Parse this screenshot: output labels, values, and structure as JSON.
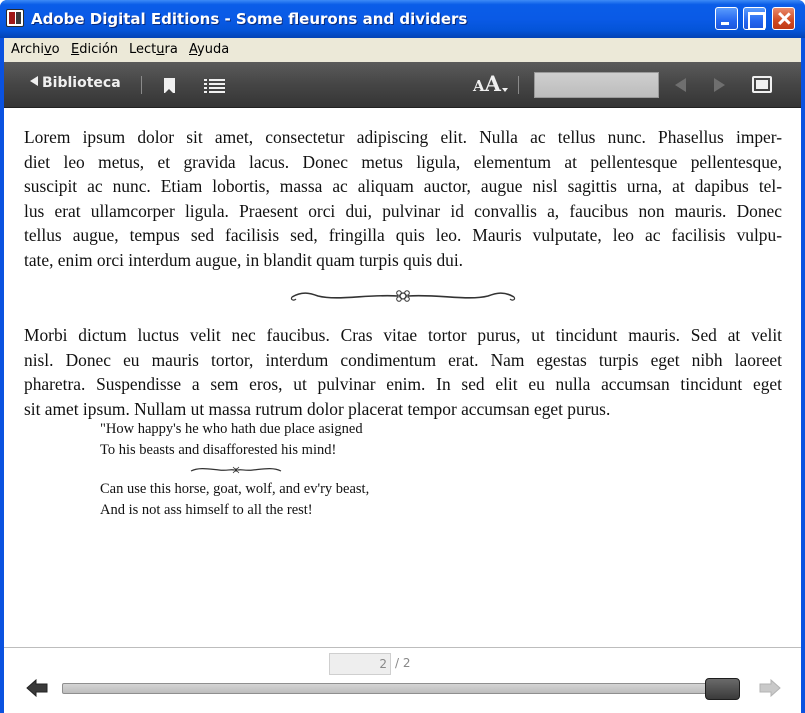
{
  "window": {
    "title": "Adobe Digital Editions - Some fleurons and dividers"
  },
  "menubar": {
    "items": [
      {
        "pre": "Archi",
        "acc": "v",
        "post": "o"
      },
      {
        "pre": "",
        "acc": "E",
        "post": "dición"
      },
      {
        "pre": "Lect",
        "acc": "u",
        "post": "ra"
      },
      {
        "pre": "",
        "acc": "A",
        "post": "yuda"
      }
    ]
  },
  "toolbar": {
    "library_label": "Biblioteca",
    "font_size_small": "A",
    "font_size_large": "A",
    "search_value": ""
  },
  "content": {
    "para1_lines": [
      "Lorem ipsum dolor sit amet, consectetur adipiscing elit. Nulla ac tellus nunc. Phasellus imper-",
      "diet leo metus, et gravida lacus. Donec metus ligula, elementum at pellentesque pellentesque,",
      "suscipit ac nunc. Etiam lobortis, massa ac aliquam auctor, augue nisl sagittis urna, at dapibus tel-",
      "lus erat ullamcorper ligula. Praesent orci dui, pulvinar id convallis a, faucibus non mauris. Donec",
      "tellus augue, tempus sed facilisis sed, fringilla quis leo. Mauris vulputate, leo ac facilisis vulpu-",
      "tate, enim orci interdum augue, in blandit quam turpis quis dui."
    ],
    "para2_lines": [
      "Morbi dictum luctus velit nec faucibus. Cras vitae tortor purus, ut tincidunt mauris. Sed at velit",
      "nisl. Donec eu mauris tortor, interdum condimentum erat. Nam egestas turpis eget nibh laoreet",
      "pharetra. Suspendisse a sem eros, ut pulvinar enim. In sed elit eu nulla accumsan tincidunt eget",
      "sit amet ipsum. Nullam ut massa rutrum dolor placerat tempor accumsan eget purus."
    ],
    "verse_stanza_1": [
      "\"How happy's he who hath due place asigned",
      "To his beasts and disafforested his mind!"
    ],
    "verse_stanza_2": [
      "Can use this horse, goat, wolf, and ev'ry beast,",
      "And is not ass himself to all the rest!"
    ]
  },
  "footer": {
    "page_current": "2",
    "page_total_text": "/ 2",
    "progress_fraction": 1.0
  },
  "colors": {
    "titlebar_blue": "#0a5ae6",
    "toolbar_dark": "#474747",
    "menubar_beige": "#ece9d8",
    "close_red": "#d04a21"
  }
}
